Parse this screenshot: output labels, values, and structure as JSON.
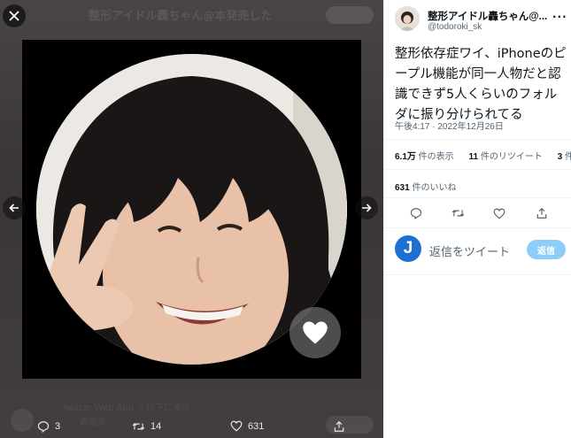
{
  "background": {
    "author_line": "整形アイドル轟ちゃん@本発売した",
    "reply_line_1": "Twitter Web App ▽ 以下に表示",
    "reply_line_2": "返信先"
  },
  "media": {
    "close_icon": "close-icon",
    "prev_icon": "chevron-left-icon",
    "next_icon": "chevron-right-icon",
    "like_overlay_icon": "heart-icon"
  },
  "bottom_bar": {
    "replies": "3",
    "retweets": "14",
    "likes": "631"
  },
  "tweet": {
    "display_name": "整形アイドル轟ちゃん@...",
    "handle": "@todoroki_sk",
    "text": "整形依存症ワイ、iPhoneのピープル機能が同一人物だと認識できず5人くらいのフォルダに振り分けられてる",
    "timestamp": "午後4:17 · 2022年12月26日",
    "views_count": "6.1万",
    "views_label": " 件の表示",
    "retweets_count": "11",
    "retweets_label": " 件のリツイート",
    "quotes_count": "3",
    "quotes_label": " 件の引",
    "likes_count": "631",
    "likes_label": " 件のいいね"
  },
  "reply": {
    "avatar_letter": "J",
    "placeholder": "返信をツイート",
    "button_label": "返信"
  },
  "colors": {
    "accent": "#1d9bf0",
    "reply_button_disabled": "#8ecdf8",
    "text_primary": "#0f1419",
    "text_secondary": "#536471"
  }
}
